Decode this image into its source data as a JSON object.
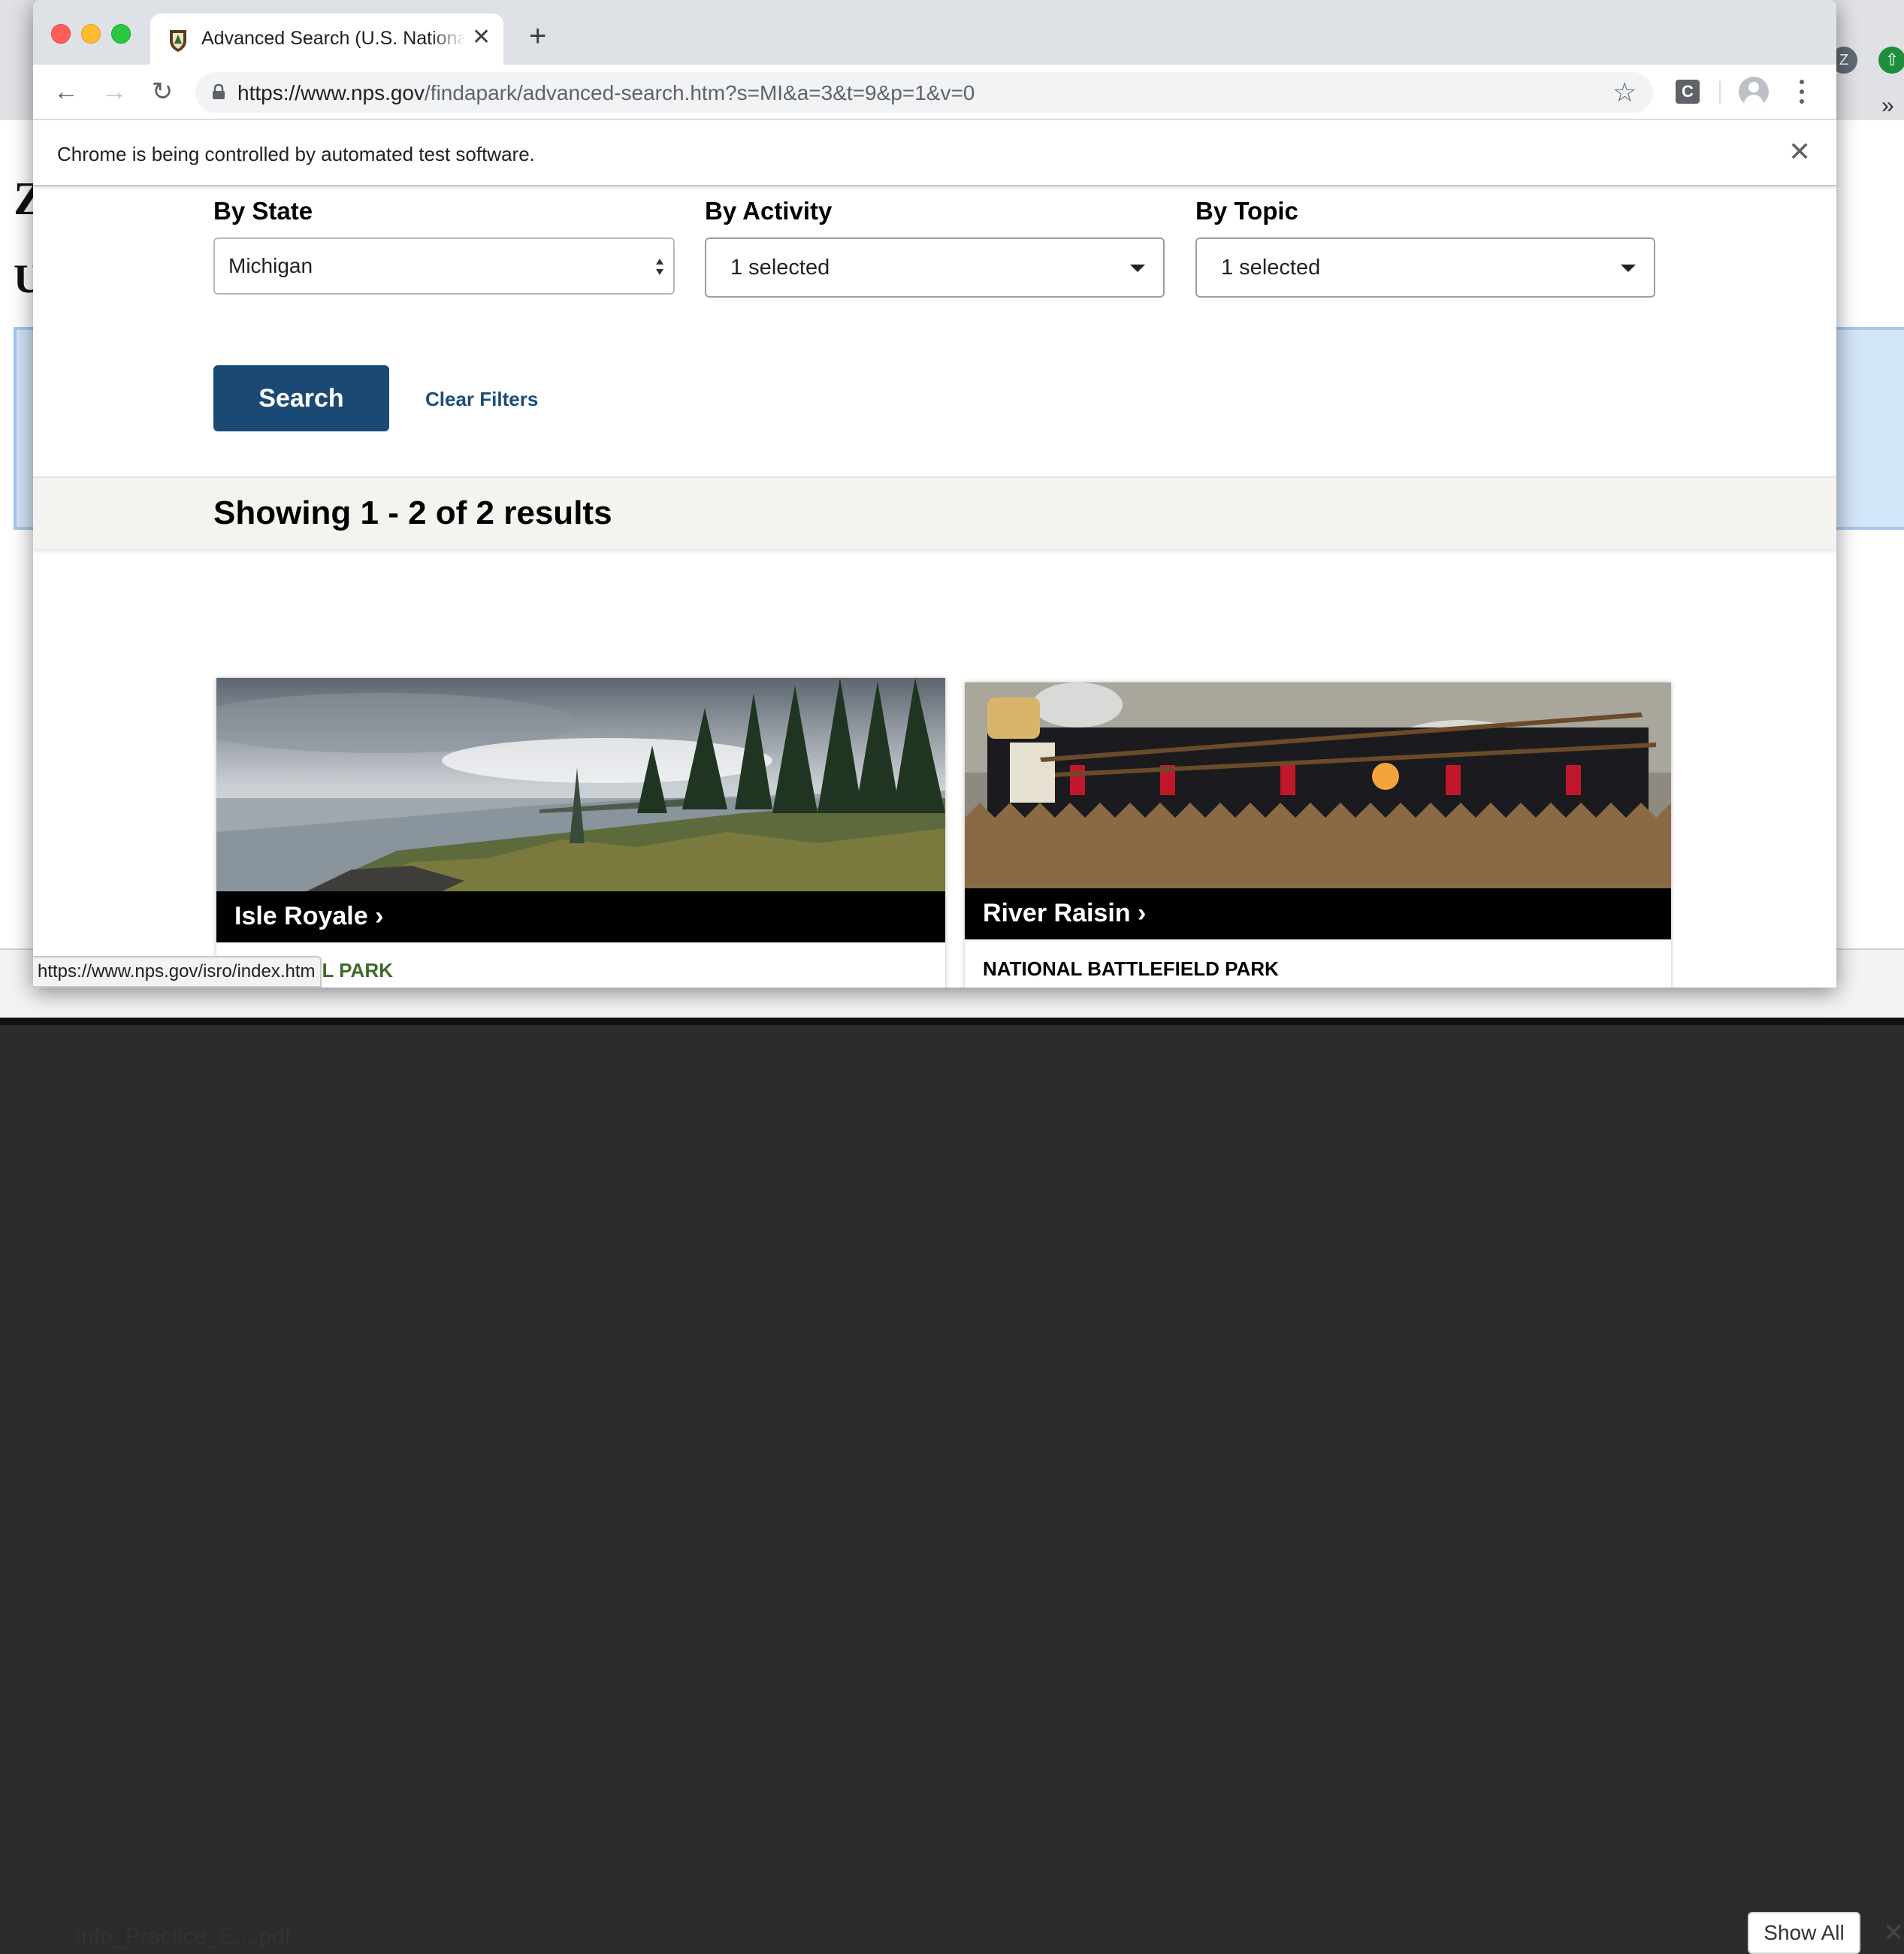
{
  "browser": {
    "tab_title": "Advanced Search (U.S. National Park Service)",
    "url_host": "https://www.nps.gov",
    "url_path": "/findapark/advanced-search.htm?s=MI&a=3&t=9&p=1&v=0",
    "infobar_text": "Chrome is being controlled by automated test software.",
    "status_url": "https://www.nps.gov/isro/index.htm",
    "extension_letter": "C"
  },
  "background": {
    "title_letter": "Z",
    "sub_letter": "U",
    "avatar_letter": "Z",
    "pdf_label": "Info_Practice_E....pdf",
    "show_all": "Show All"
  },
  "filters": {
    "state_label": "By State",
    "state_value": "Michigan",
    "activity_label": "By Activity",
    "activity_value": "1 selected",
    "topic_label": "By Topic",
    "topic_value": "1 selected",
    "search_button": "Search",
    "clear_filters": "Clear Filters"
  },
  "results": {
    "summary": "Showing 1 - 2 of 2 results",
    "cards": [
      {
        "name": "Isle Royale",
        "designation": "NATIONAL PARK"
      },
      {
        "name": "River Raisin",
        "designation": "NATIONAL BATTLEFIELD PARK"
      }
    ]
  },
  "colors": {
    "primary_button": "#1a4a74",
    "link": "#1b4d7a",
    "results_bar": "#f4f3ef",
    "caption_bg": "#000000",
    "park_green": "#3c6b2a"
  },
  "icons": [
    "back-arrow-icon",
    "forward-arrow-icon",
    "reload-icon",
    "lock-icon",
    "star-icon",
    "profile-icon",
    "kebab-menu-icon",
    "close-icon",
    "updown-icon",
    "caret-down-icon"
  ]
}
